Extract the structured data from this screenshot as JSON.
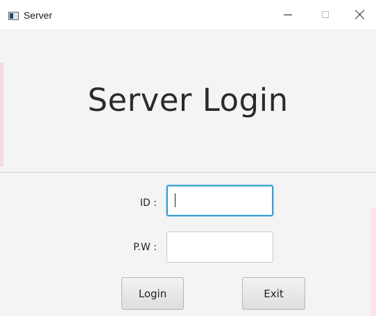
{
  "window": {
    "title": "Server",
    "icon": "java-app-icon",
    "controls": {
      "minimize": "minimize-icon",
      "maximize": "maximize-icon",
      "close": "close-icon"
    }
  },
  "main": {
    "heading": "Server Login"
  },
  "form": {
    "id_label": "ID :",
    "id_value": "",
    "pw_label": "P.W :",
    "pw_value": ""
  },
  "buttons": {
    "login_label": "Login",
    "exit_label": "Exit"
  },
  "colors": {
    "focus_border": "#3ea0d4",
    "window_background": "#f4f4f4"
  }
}
